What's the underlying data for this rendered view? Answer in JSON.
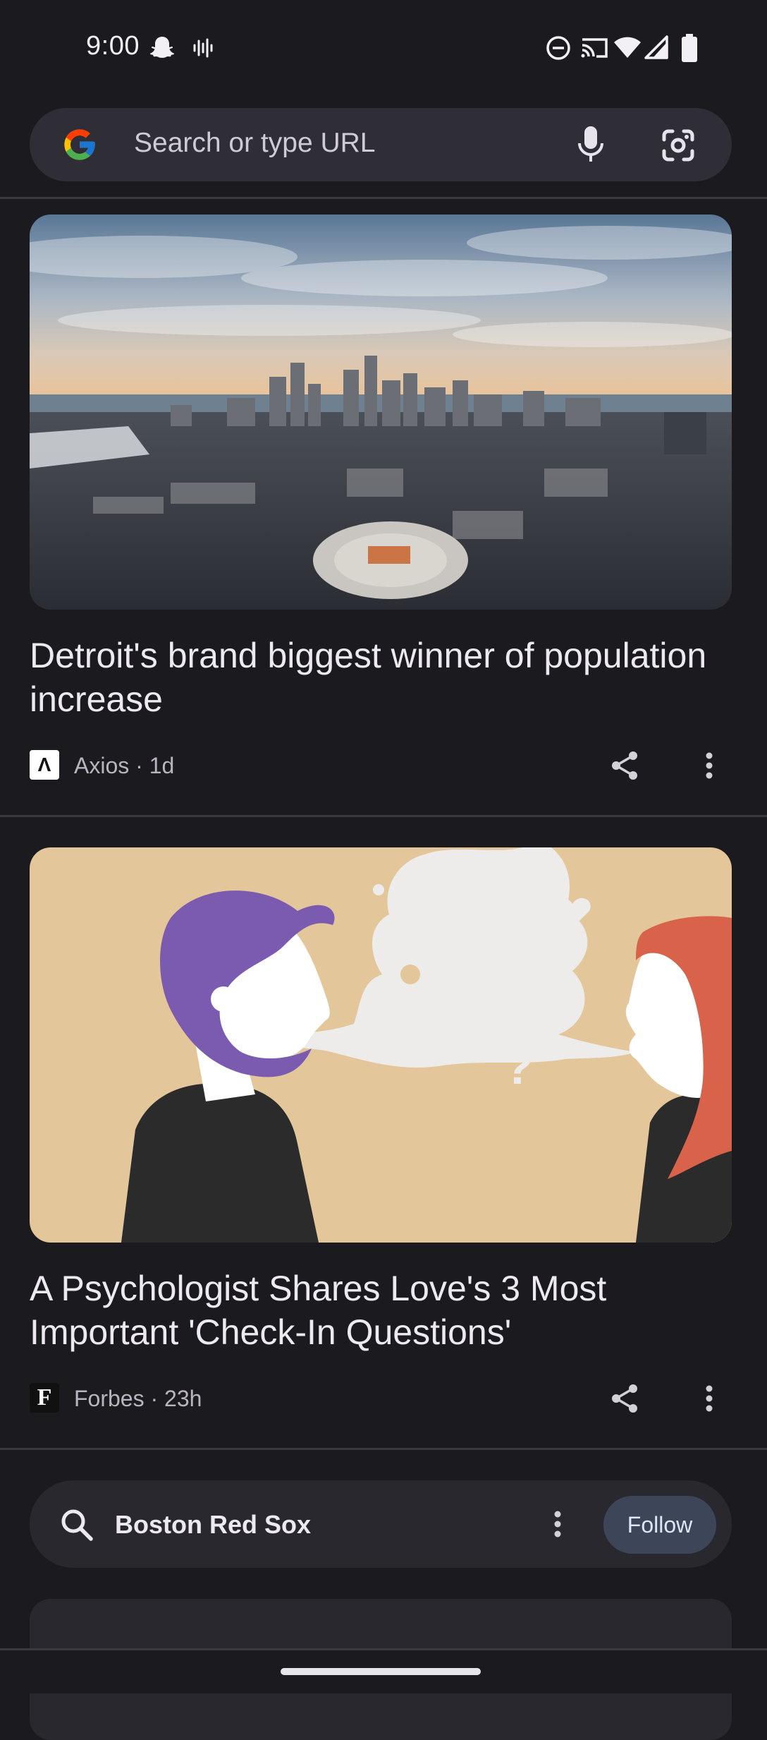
{
  "status_bar": {
    "time": "9:00",
    "icons": [
      "snapchat-icon",
      "voice-wave-icon",
      "do-not-disturb-icon",
      "cast-icon",
      "wifi-icon",
      "signal-icon",
      "battery-icon"
    ]
  },
  "search": {
    "placeholder": "Search or type URL",
    "icons": [
      "google-logo",
      "microphone-icon",
      "lens-camera-icon"
    ]
  },
  "feed": {
    "articles": [
      {
        "headline": "Detroit's brand biggest winner of population increase",
        "source": "Axios · 1d",
        "publisher_logo": "Λ",
        "image": "aerial view of Detroit skyline with arena at sunset"
      },
      {
        "headline": "A Psychologist Shares Love's 3 Most Important 'Check-In Questions'",
        "source": "Forbes · 23h",
        "publisher_logo": "F",
        "image": "illustration of man and woman sharing a speech bubble"
      }
    ],
    "topic": {
      "label": "Boston Red Sox",
      "follow_label": "Follow"
    }
  },
  "colors": {
    "background": "#1b1b1f",
    "search_bg": "#2f2e37",
    "follow_bg": "#3d4658",
    "illustration_bg": "#e3c69a",
    "man_hair": "#7b5bb0",
    "woman_hair": "#d8634a"
  }
}
